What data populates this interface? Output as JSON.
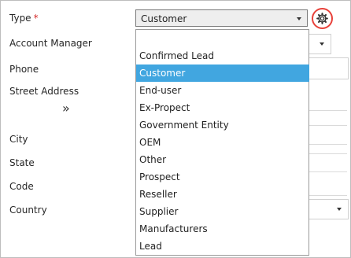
{
  "form": {
    "type_label": "Type",
    "required_mark": "*",
    "account_manager_label": "Account Manager",
    "phone_label": "Phone",
    "street_address_label": "Street Address",
    "expand_glyph": "»",
    "city_label": "City",
    "state_label": "State",
    "code_label": "Code",
    "country_label": "Country"
  },
  "type_select": {
    "value": "Customer",
    "options": [
      "Confirmed Lead",
      "Customer",
      "End-user",
      "Ex-Propect",
      "Government Entity",
      "OEM",
      "Other",
      "Prospect",
      "Reseller",
      "Supplier",
      "Manufacturers",
      "Lead"
    ],
    "highlighted": "Customer"
  },
  "icons": {
    "settings": "gear-icon",
    "select_caret": "caret-down-icon"
  },
  "colors": {
    "highlight": "#41a6e0",
    "required": "#d62b2b",
    "settings_ring": "#e8413a"
  }
}
